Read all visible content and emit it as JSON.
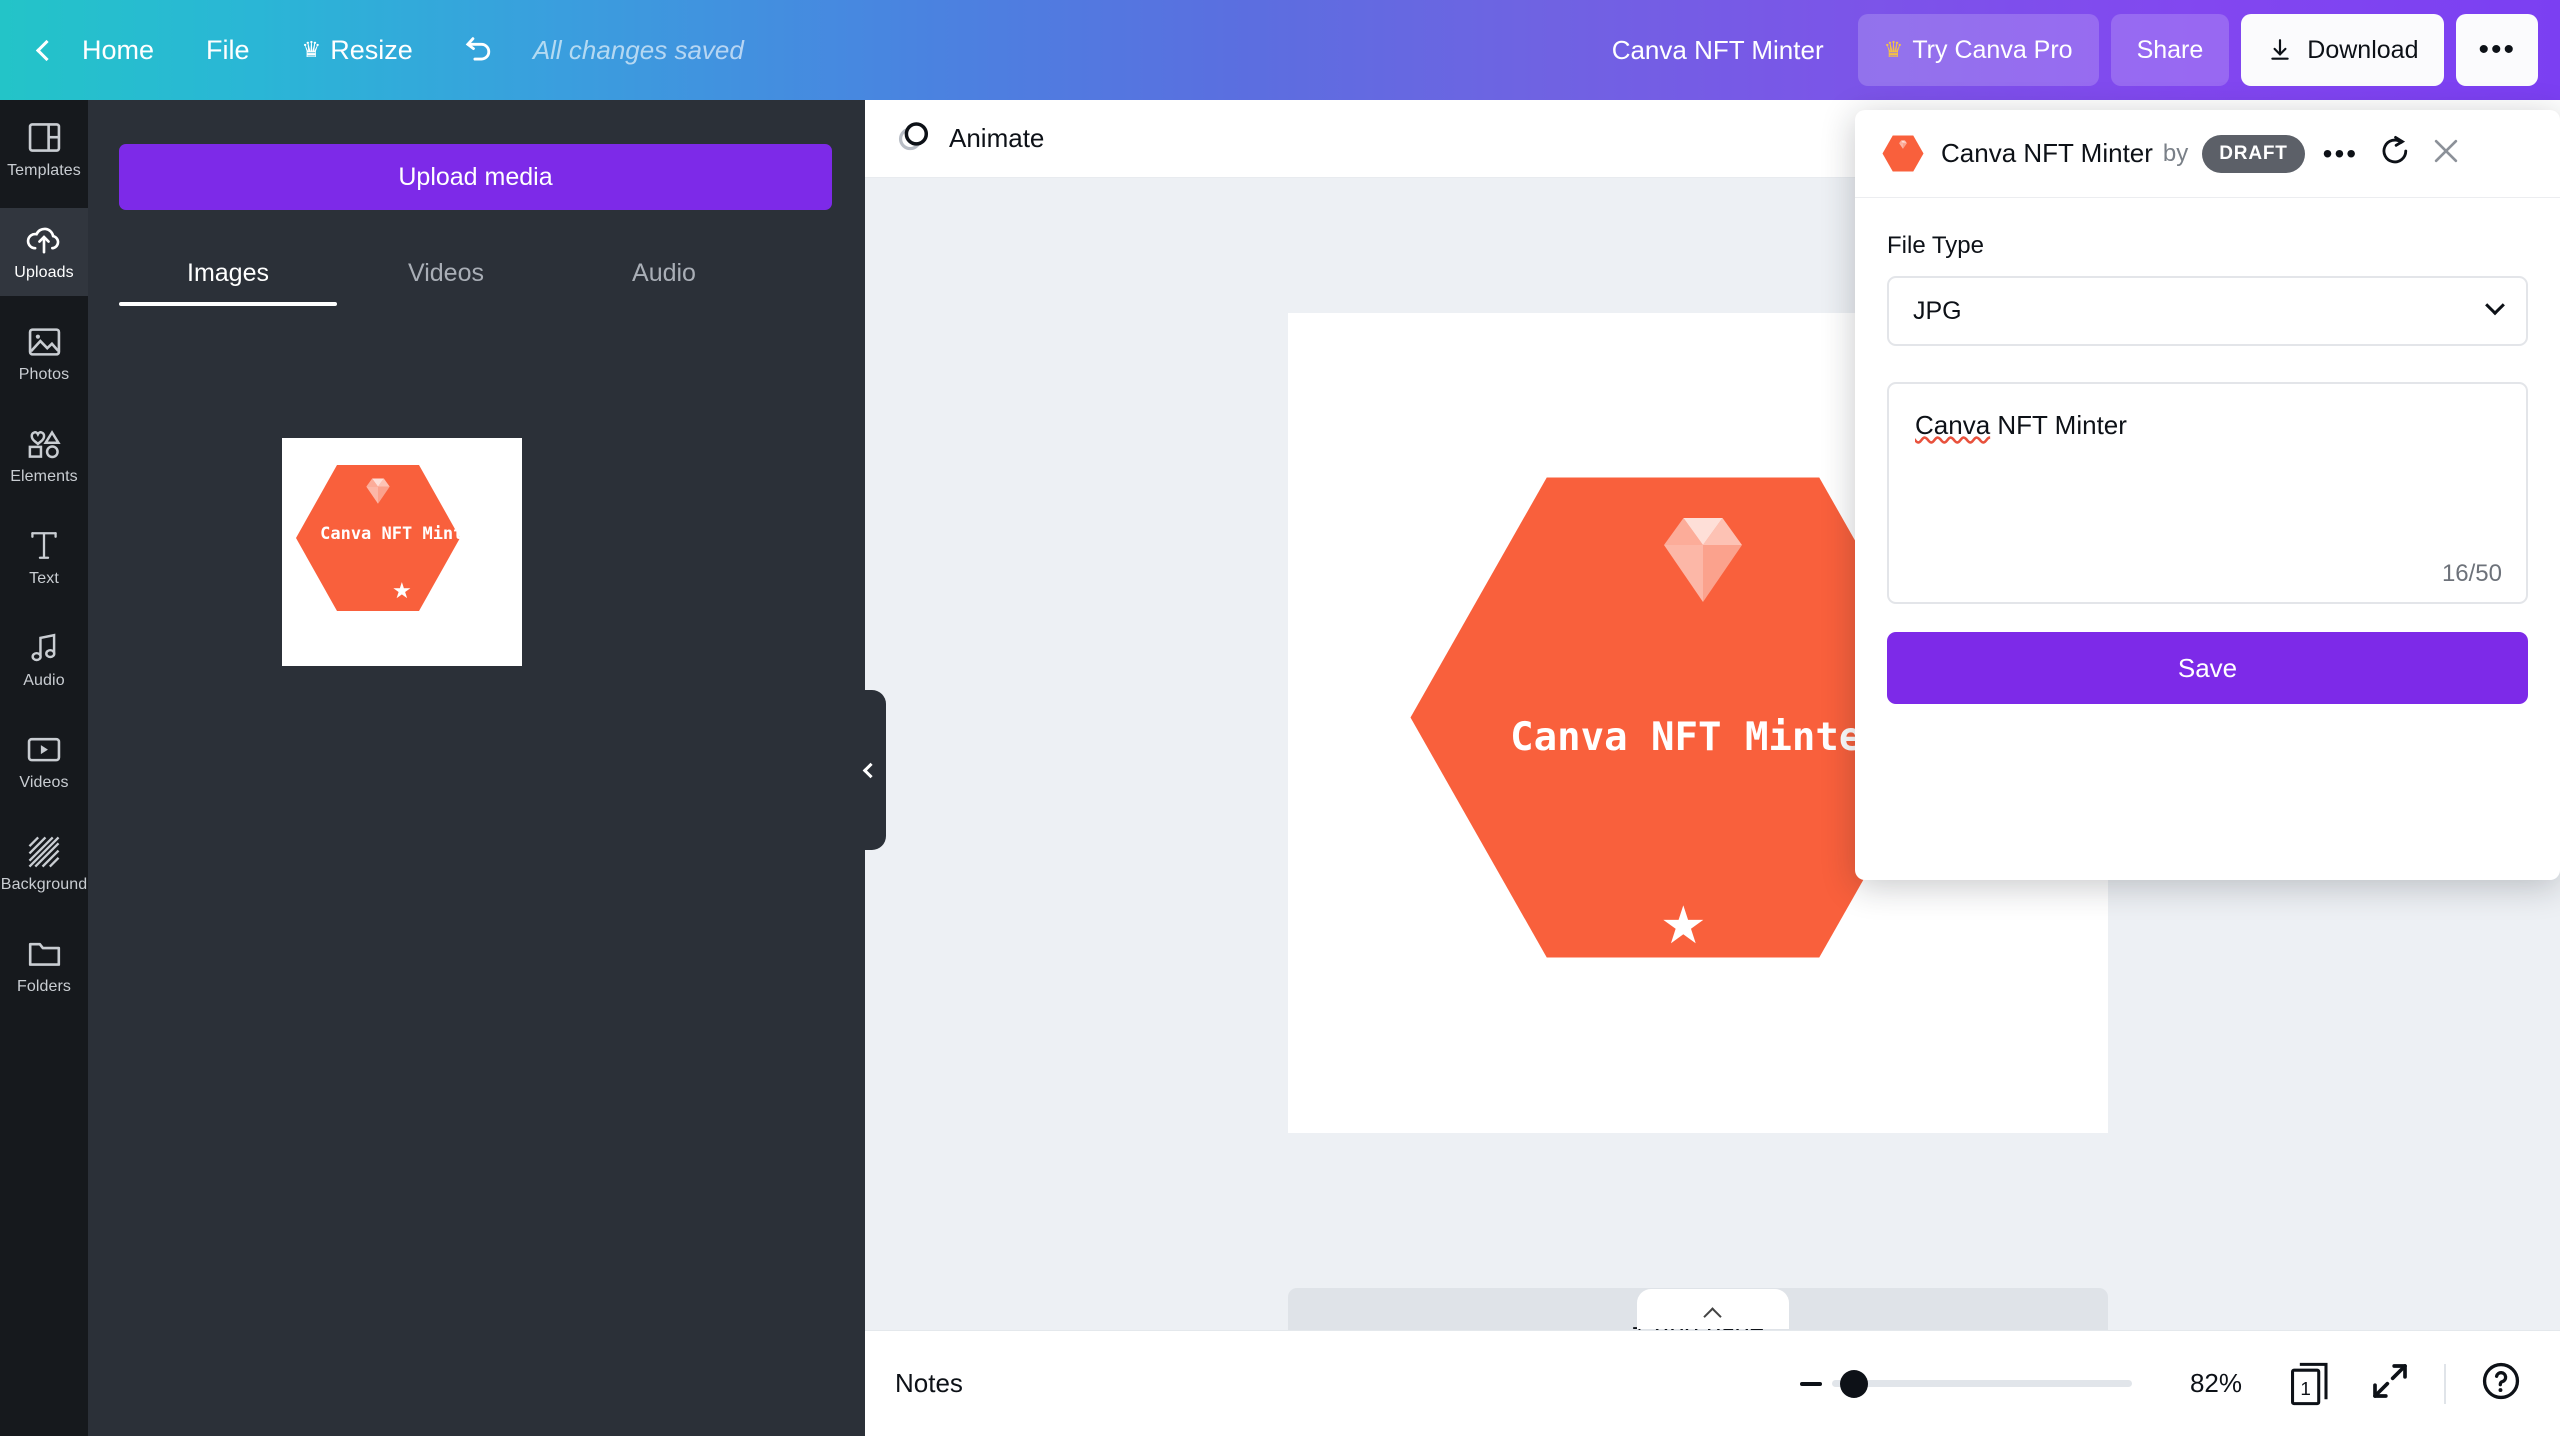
{
  "topbar": {
    "back_icon": "chevron-left-icon",
    "home_label": "Home",
    "file_label": "File",
    "resize_label": "Resize",
    "resize_icon": "crown-icon",
    "undo_icon": "undo-icon",
    "save_status": "All changes saved",
    "doc_title": "Canva NFT Minter",
    "try_pro_label": "Try Canva Pro",
    "try_pro_icon": "crown-icon",
    "share_label": "Share",
    "download_label": "Download",
    "download_icon": "download-icon",
    "more_label": "•••",
    "gradient_start": "#23c4c8",
    "gradient_end": "#7b3ff2"
  },
  "sidebar": {
    "items": [
      {
        "label": "Templates",
        "icon": "templates-icon",
        "active": false
      },
      {
        "label": "Uploads",
        "icon": "upload-cloud-icon",
        "active": true
      },
      {
        "label": "Photos",
        "icon": "photo-icon",
        "active": false
      },
      {
        "label": "Elements",
        "icon": "shapes-icon",
        "active": false
      },
      {
        "label": "Text",
        "icon": "text-t-icon",
        "active": false
      },
      {
        "label": "Audio",
        "icon": "music-note-icon",
        "active": false
      },
      {
        "label": "Videos",
        "icon": "video-play-icon",
        "active": false
      },
      {
        "label": "Background",
        "icon": "hatch-pattern-icon",
        "active": false
      },
      {
        "label": "Folders",
        "icon": "folder-icon",
        "active": false
      }
    ]
  },
  "uploads_panel": {
    "upload_button": "Upload media",
    "tabs": [
      {
        "label": "Images",
        "active": true
      },
      {
        "label": "Videos",
        "active": false
      },
      {
        "label": "Audio",
        "active": false
      }
    ],
    "thumbnail": {
      "title": "Canva NFT Minter",
      "badge_color": "#f9603c",
      "gem_icon": "diamond-icon",
      "star_icon": "star-icon"
    }
  },
  "stage": {
    "animate_label": "Animate",
    "animate_icon": "animate-circles-icon",
    "collapse_icon": "chevron-left-icon",
    "add_page_label": "+ Add page",
    "notes_toggle_icon": "chevron-up-icon",
    "design": {
      "title": "Canva NFT Minter",
      "hex_color": "#f9603c",
      "gem_icon": "diamond-icon",
      "star_icon": "star-icon"
    }
  },
  "statusbar": {
    "notes_label": "Notes",
    "zoom_value": "82%",
    "page_number": "1",
    "page_icon": "pages-icon",
    "expand_icon": "fullscreen-icon",
    "help_icon": "help-circle-icon",
    "zoom_minus_icon": "minus-icon"
  },
  "dialog": {
    "app_icon": "canva-nft-minter-hex-icon",
    "title": "Canva NFT Minter",
    "by_label": "by",
    "badge": "DRAFT",
    "more_icon": "•••",
    "refresh_icon": "refresh-icon",
    "close_icon": "close-icon",
    "file_type_label": "File Type",
    "file_type_value": "JPG",
    "dropdown_icon": "chevron-down-icon",
    "name_value_spell": "Canva",
    "name_value_rest": " NFT Minter",
    "counter": "16/50",
    "save_label": "Save",
    "accent_color": "#7d2ae8"
  }
}
